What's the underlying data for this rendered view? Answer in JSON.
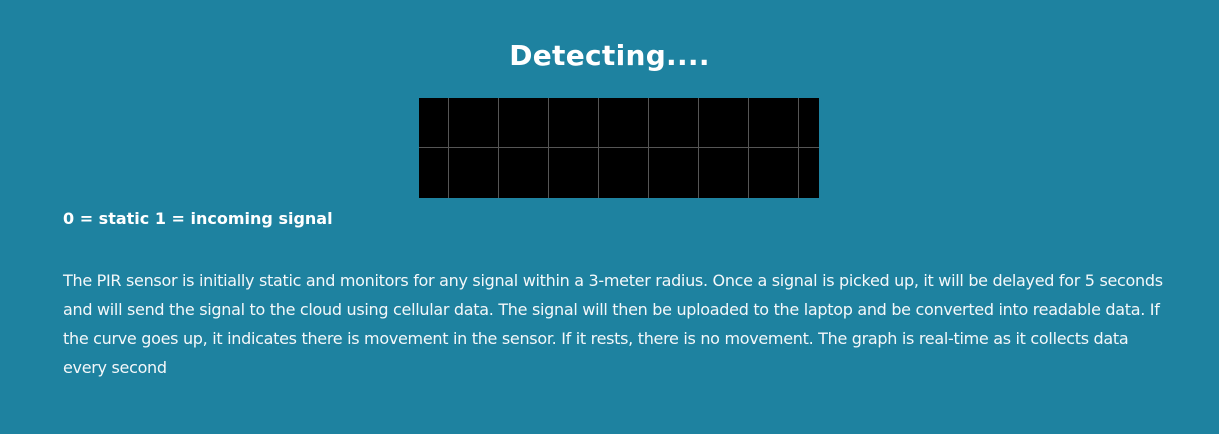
{
  "page": {
    "title": "Detecting....",
    "legend": "0 = static 1 = incoming signal",
    "description": "The PIR sensor is initially static and monitors for any signal within a 3-meter radius. Once a signal is picked up, it will be delayed for 5 seconds and will send the signal to the cloud using cellular data. The signal will then be uploaded to the laptop and be converted into readable data. If the curve goes up, it indicates there is movement in the sensor. If it rests, there is no movement. The graph is real-time as it collects data every second"
  },
  "graph": {
    "background": "#000000",
    "grid_color": "#555555",
    "grid": true
  },
  "colors": {
    "background": "#1e82a0",
    "text": "#ffffff"
  }
}
